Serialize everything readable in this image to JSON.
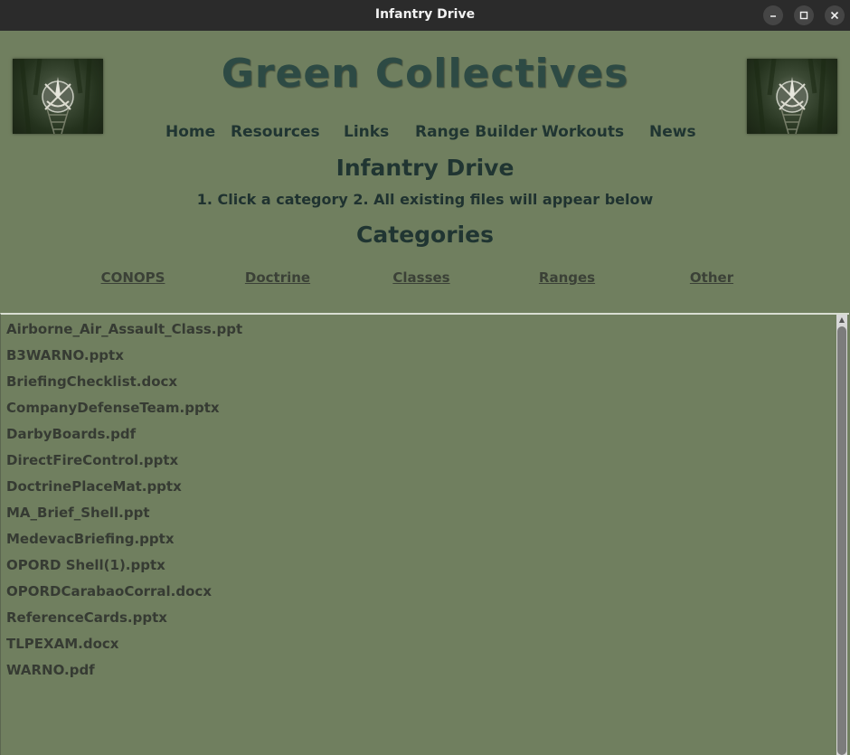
{
  "window": {
    "title": "Infantry Drive",
    "minimize_icon": "minimize-icon",
    "maximize_icon": "maximize-icon",
    "close_icon": "close-icon"
  },
  "header": {
    "site_title": "Green Collectives",
    "logo_icon": "special-forces-crest-icon"
  },
  "nav": {
    "items": [
      "Home",
      "Resources",
      "Links",
      "Range Builder",
      "Workouts",
      "News"
    ]
  },
  "main": {
    "page_heading": "Infantry Drive",
    "instructions": "1. Click a category 2. All existing files will appear below",
    "categories_heading": "Categories",
    "categories": [
      "CONOPS",
      "Doctrine",
      "Classes",
      "Ranges",
      "Other"
    ]
  },
  "files": [
    "Airborne_Air_Assault_Class.ppt",
    "B3WARNO.pptx",
    "BriefingChecklist.docx",
    "CompanyDefenseTeam.pptx",
    "DarbyBoards.pdf",
    "DirectFireControl.pptx",
    "DoctrinePlaceMat.pptx",
    "MA_Brief_Shell.ppt",
    "MedevacBriefing.pptx",
    "OPORD Shell(1).pptx",
    "OPORDCarabaoCorral.docx",
    "ReferenceCards.pptx",
    "TLPEXAM.docx",
    "WARNO.pdf"
  ],
  "colors": {
    "background": "#707f5f",
    "title": "#2d4a44",
    "titlebar": "#2b2b2b"
  }
}
